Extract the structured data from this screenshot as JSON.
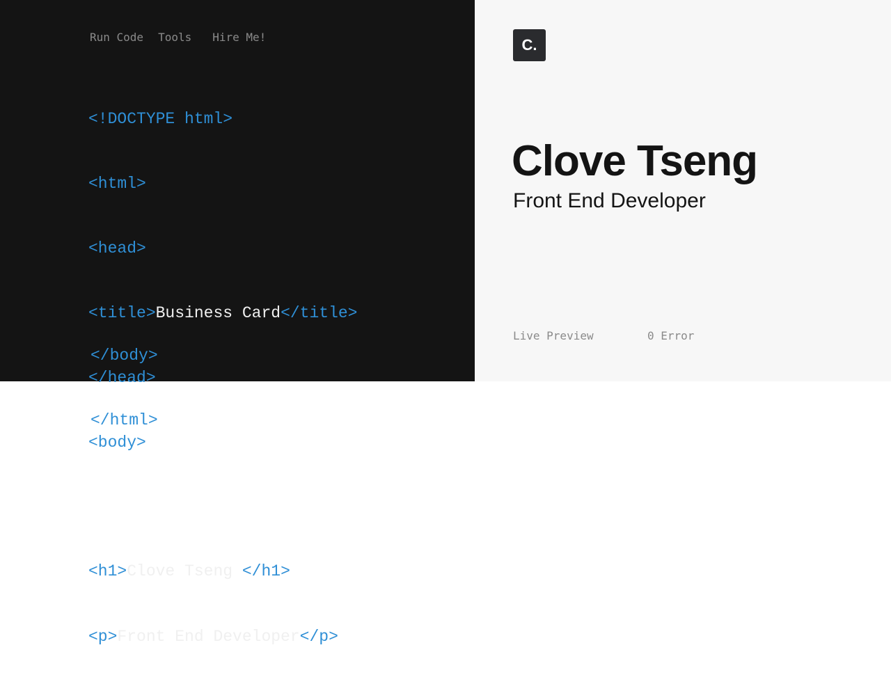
{
  "editor": {
    "menu": [
      "Run Code",
      "Tools",
      "Hire Me!"
    ],
    "lines": [
      {
        "tag1": "<!DOCTYPE html>",
        "text": "",
        "tag2": ""
      },
      {
        "tag1": "<html>",
        "text": "",
        "tag2": ""
      },
      {
        "tag1": "<head>",
        "text": "",
        "tag2": ""
      },
      {
        "tag1": "<title>",
        "text": "Business Card",
        "tag2": "</title>"
      },
      {
        "tag1": "</head>",
        "text": "",
        "tag2": ""
      },
      {
        "tag1": "<body>",
        "text": "",
        "tag2": ""
      },
      {
        "tag1": "<h1>",
        "text": "Clove Tseng ",
        "tag2": "</h1>"
      },
      {
        "tag1": "<p>",
        "text": "Front End Developer",
        "tag2": "</p>"
      },
      {
        "tag1": "</body>",
        "text": "",
        "tag2": ""
      },
      {
        "tag1": "</html>",
        "text": "",
        "tag2": ""
      }
    ],
    "colors": {
      "background": "#141414",
      "tag": "#2f8fd6",
      "text": "#f0f0f0"
    }
  },
  "preview": {
    "logo": "C.",
    "name": "Clove Tseng",
    "role": "Front End Developer",
    "status_live": "Live Preview",
    "status_errors": "0 Error",
    "colors": {
      "background": "#f7f7f7",
      "logo_bg": "#2a2b2e"
    }
  }
}
